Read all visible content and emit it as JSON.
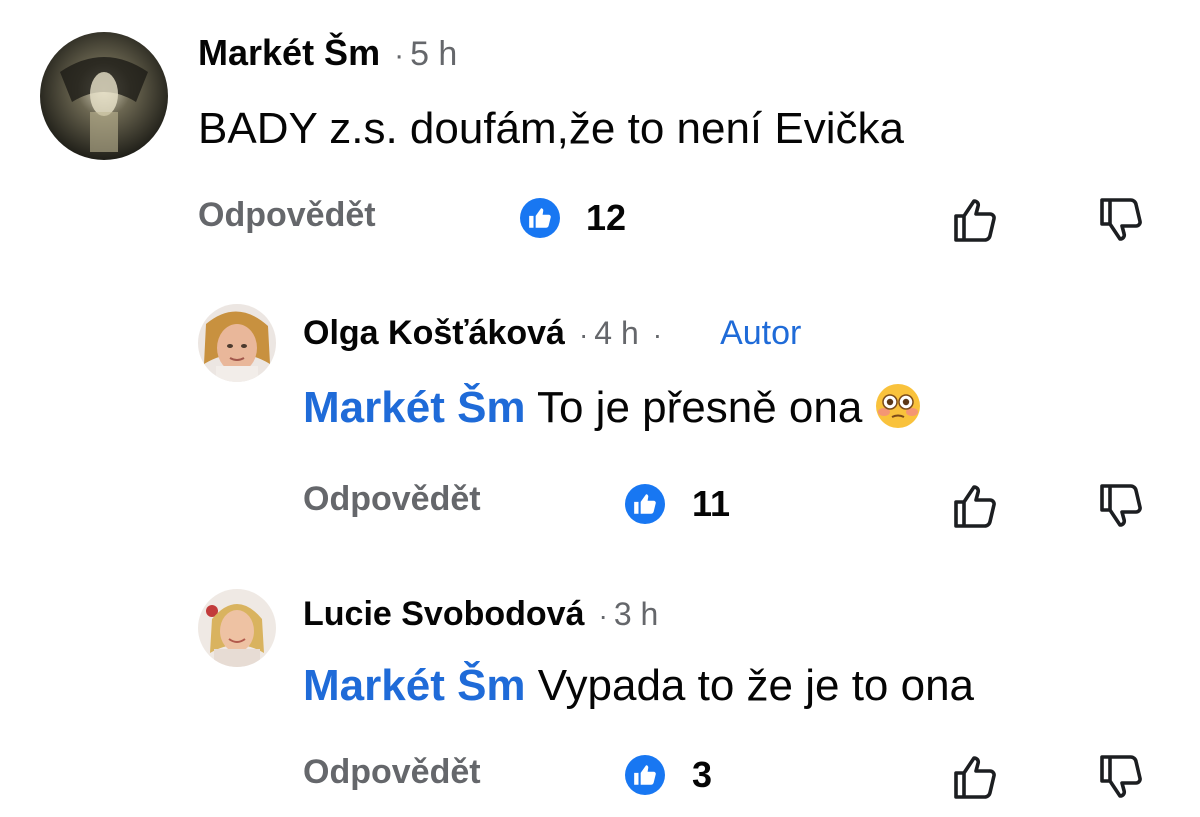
{
  "comments": [
    {
      "author": "Markét Šm",
      "separator": "·",
      "time": "5 h",
      "mention": "",
      "text": "BADY z.s. doufám,že to není Evička",
      "reply_label": "Odpovědět",
      "like_count": "12"
    },
    {
      "author": "Olga Košťáková",
      "separator": "·",
      "time": "4 h",
      "separator2": "·",
      "badge": "Autor",
      "mention": "Markét Šm",
      "text": "To je přesně ona",
      "emoji": "flushed-face",
      "reply_label": "Odpovědět",
      "like_count": "11"
    },
    {
      "author": "Lucie Svobodová",
      "separator": "·",
      "time": "3 h",
      "mention": "Markét Šm",
      "text": "Vypada to že je to ona",
      "reply_label": "Odpovědět",
      "like_count": "3"
    }
  ],
  "colors": {
    "mention": "#1f6bd8",
    "like_badge": "#1877f2",
    "secondary_text": "#65676b"
  }
}
